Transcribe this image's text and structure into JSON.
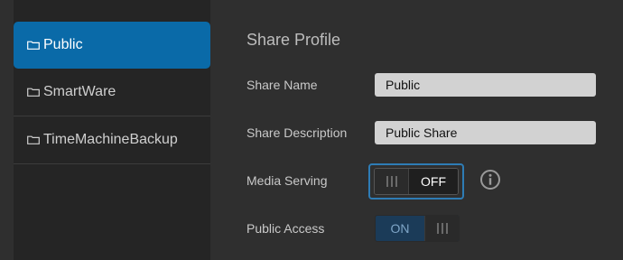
{
  "sidebar": {
    "items": [
      {
        "label": "Public",
        "selected": true,
        "icon": "folder-icon"
      },
      {
        "label": "SmartWare",
        "selected": false,
        "icon": "folder-icon"
      },
      {
        "label": "TimeMachineBackup",
        "selected": false,
        "icon": "folder-icon"
      }
    ]
  },
  "profile": {
    "title": "Share Profile",
    "share_name_label": "Share Name",
    "share_name_value": "Public",
    "share_description_label": "Share Description",
    "share_description_value": "Public Share",
    "media_serving_label": "Media Serving",
    "media_serving_state": "OFF",
    "public_access_label": "Public Access",
    "public_access_state": "ON",
    "info_icon": "info-icon"
  },
  "colors": {
    "accent": "#0a6aa8",
    "background": "#2f2f2f",
    "sidebar": "#252525",
    "focus_ring": "#2e7cb5"
  }
}
